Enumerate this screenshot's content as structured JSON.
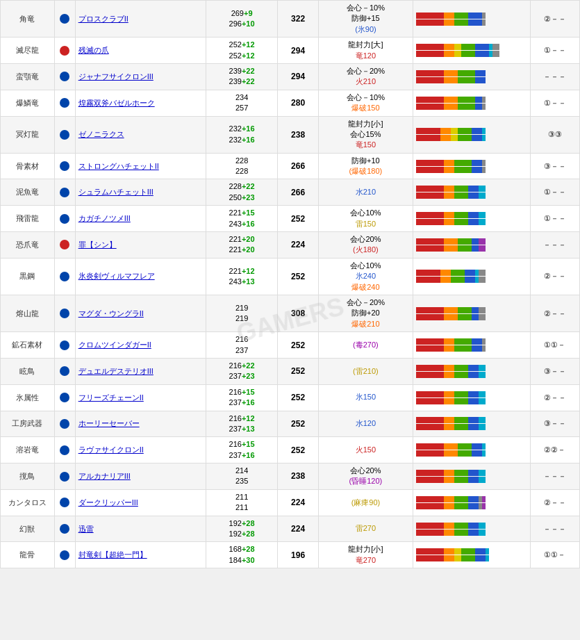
{
  "watermark": "GAMERS",
  "rows": [
    {
      "type": "角竜",
      "icon": "blue",
      "name": "プロスクラブII",
      "atk1": "269",
      "atk1p": "+9",
      "atk2": "296",
      "atk2p": "+10",
      "total": "322",
      "eff_line1": "会心－10%",
      "eff_line2": "防御+15",
      "eff_line3": "(氷90)",
      "eff1_color": "normal",
      "eff2_color": "normal",
      "eff3_color": "blue_paren",
      "rank": "②－－",
      "bars": [
        [
          40,
          15,
          0,
          20,
          20,
          0,
          5,
          0
        ],
        [
          40,
          15,
          0,
          20,
          20,
          0,
          5,
          0
        ]
      ]
    },
    {
      "type": "滅尽龍",
      "icon": "red",
      "name": "残滅の爪",
      "atk1": "252",
      "atk1p": "+12",
      "atk2": "252",
      "atk2p": "+12",
      "total": "294",
      "eff_line1": "龍封力[大]",
      "eff_line2": "竜120",
      "eff_line3": "",
      "eff1_color": "normal",
      "eff2_color": "red",
      "eff3_color": "normal",
      "rank": "①－－",
      "bars": [
        [
          40,
          15,
          10,
          20,
          20,
          5,
          10,
          0
        ],
        [
          40,
          15,
          10,
          20,
          20,
          5,
          10,
          0
        ]
      ]
    },
    {
      "type": "蛮顎竜",
      "icon": "blue",
      "name": "ジャナフサイクロンIII",
      "atk1": "239",
      "atk1p": "+22",
      "atk2": "239",
      "atk2p": "+22",
      "total": "294",
      "eff_line1": "会心－20%",
      "eff_line2": "火210",
      "eff_line3": "",
      "eff1_color": "normal",
      "eff2_color": "red",
      "eff3_color": "normal",
      "rank": "－－－",
      "bars": [
        [
          40,
          20,
          0,
          25,
          15,
          0,
          0,
          0
        ],
        [
          40,
          20,
          0,
          25,
          15,
          0,
          0,
          0
        ]
      ]
    },
    {
      "type": "爆鱗竜",
      "icon": "blue",
      "name": "煌霧双斧バゼルホーク",
      "atk1": "234",
      "atk1p": "",
      "atk2": "257",
      "atk2p": "",
      "total": "280",
      "eff_line1": "会心－10%",
      "eff_line2": "爆破150",
      "eff_line3": "",
      "eff1_color": "normal",
      "eff2_color": "orange",
      "eff3_color": "normal",
      "rank": "①－－",
      "bars": [
        [
          40,
          20,
          0,
          25,
          10,
          0,
          5,
          0
        ],
        [
          40,
          20,
          0,
          25,
          10,
          0,
          5,
          0
        ]
      ]
    },
    {
      "type": "冥灯龍",
      "icon": "blue",
      "name": "ゼノニラクス",
      "atk1": "232",
      "atk1p": "+16",
      "atk2": "232",
      "atk2p": "+16",
      "total": "238",
      "eff_line1": "龍封力[小]",
      "eff_line2": "会心15%",
      "eff_line3": "竜150",
      "eff1_color": "normal",
      "eff2_color": "normal",
      "eff3_color": "red",
      "rank": "③③",
      "bars": [
        [
          35,
          15,
          10,
          20,
          15,
          5,
          0,
          0
        ],
        [
          35,
          15,
          10,
          20,
          15,
          5,
          0,
          0
        ]
      ]
    },
    {
      "type": "骨素材",
      "icon": "blue",
      "name": "ストロングハチェットII",
      "atk1": "228",
      "atk1p": "",
      "atk2": "228",
      "atk2p": "",
      "total": "266",
      "eff_line1": "防御+10",
      "eff_line2": "(爆破180)",
      "eff_line3": "",
      "eff1_color": "normal",
      "eff2_color": "orange_paren",
      "eff3_color": "normal",
      "rank": "③－－",
      "bars": [
        [
          40,
          15,
          0,
          25,
          15,
          0,
          5,
          0
        ],
        [
          40,
          15,
          0,
          25,
          15,
          0,
          5,
          0
        ]
      ]
    },
    {
      "type": "泥魚竜",
      "icon": "blue",
      "name": "シュラムハチェットIII",
      "atk1": "228",
      "atk1p": "+22",
      "atk2": "250",
      "atk2p": "+23",
      "total": "266",
      "eff_line1": "水210",
      "eff_line2": "",
      "eff_line3": "",
      "eff1_color": "blue",
      "eff2_color": "normal",
      "eff3_color": "normal",
      "rank": "①－－",
      "bars": [
        [
          40,
          15,
          0,
          20,
          15,
          10,
          0,
          0
        ],
        [
          40,
          15,
          0,
          20,
          15,
          10,
          0,
          0
        ]
      ]
    },
    {
      "type": "飛雷龍",
      "icon": "blue",
      "name": "カガチノツメIII",
      "atk1": "221",
      "atk1p": "+15",
      "atk2": "243",
      "atk2p": "+16",
      "total": "252",
      "eff_line1": "会心10%",
      "eff_line2": "雷150",
      "eff_line3": "",
      "eff1_color": "normal",
      "eff2_color": "yellow",
      "eff3_color": "normal",
      "rank": "①－－",
      "bars": [
        [
          40,
          15,
          0,
          20,
          15,
          10,
          0,
          0
        ],
        [
          40,
          15,
          0,
          20,
          15,
          10,
          0,
          0
        ]
      ]
    },
    {
      "type": "恐爪竜",
      "icon": "red",
      "name": "罪【シン】",
      "atk1": "221",
      "atk1p": "+20",
      "atk2": "221",
      "atk2p": "+20",
      "total": "224",
      "eff_line1": "会心20%",
      "eff_line2": "(火180)",
      "eff_line3": "",
      "eff1_color": "normal",
      "eff2_color": "red_paren",
      "eff3_color": "normal",
      "rank": "－－－",
      "bars": [
        [
          40,
          20,
          0,
          20,
          10,
          0,
          0,
          10
        ],
        [
          40,
          20,
          0,
          20,
          10,
          0,
          0,
          10
        ]
      ]
    },
    {
      "type": "黒鋼",
      "icon": "blue",
      "name": "氷炎剣ヴィルマフレア",
      "atk1": "221",
      "atk1p": "+12",
      "atk2": "243",
      "atk2p": "+13",
      "total": "252",
      "eff_line1": "会心10%",
      "eff_line2": "氷240",
      "eff_line3": "爆破240",
      "eff1_color": "normal",
      "eff2_color": "blue",
      "eff3_color": "orange",
      "rank": "②－－",
      "bars": [
        [
          35,
          15,
          0,
          20,
          15,
          5,
          10,
          0
        ],
        [
          35,
          15,
          0,
          20,
          15,
          5,
          10,
          0
        ]
      ]
    },
    {
      "type": "熔山龍",
      "icon": "blue",
      "name": "マグダ・ウングラII",
      "atk1": "219",
      "atk1p": "",
      "atk2": "219",
      "atk2p": "",
      "total": "308",
      "eff_line1": "会心－20%",
      "eff_line2": "防御+20",
      "eff_line3": "爆破210",
      "eff1_color": "normal",
      "eff2_color": "normal",
      "eff3_color": "orange",
      "rank": "②－－",
      "bars": [
        [
          40,
          20,
          0,
          20,
          10,
          0,
          10,
          0
        ],
        [
          40,
          20,
          0,
          20,
          10,
          0,
          10,
          0
        ]
      ]
    },
    {
      "type": "鉱石素材",
      "icon": "blue",
      "name": "クロムツインダガーII",
      "atk1": "216",
      "atk1p": "",
      "atk2": "237",
      "atk2p": "",
      "total": "252",
      "eff_line1": "(毒270)",
      "eff_line2": "",
      "eff_line3": "",
      "eff1_color": "purple_paren",
      "eff2_color": "normal",
      "eff3_color": "normal",
      "rank": "①①－",
      "bars": [
        [
          40,
          15,
          0,
          25,
          15,
          0,
          5,
          0
        ],
        [
          40,
          15,
          0,
          25,
          15,
          0,
          5,
          0
        ]
      ]
    },
    {
      "type": "眩鳥",
      "icon": "blue",
      "name": "デュエルデステリオIII",
      "atk1": "216",
      "atk1p": "+22",
      "atk2": "237",
      "atk2p": "+23",
      "total": "252",
      "eff_line1": "(雷210)",
      "eff_line2": "",
      "eff_line3": "",
      "eff1_color": "yellow_paren",
      "eff2_color": "normal",
      "eff3_color": "normal",
      "rank": "③－－",
      "bars": [
        [
          40,
          15,
          0,
          20,
          15,
          10,
          0,
          0
        ],
        [
          40,
          15,
          0,
          20,
          15,
          10,
          0,
          0
        ]
      ]
    },
    {
      "type": "氷属性",
      "icon": "blue",
      "name": "フリーズチェーンII",
      "atk1": "216",
      "atk1p": "+15",
      "atk2": "237",
      "atk2p": "+16",
      "total": "252",
      "eff_line1": "氷150",
      "eff_line2": "",
      "eff_line3": "",
      "eff1_color": "blue",
      "eff2_color": "normal",
      "eff3_color": "normal",
      "rank": "②－－",
      "bars": [
        [
          40,
          15,
          0,
          20,
          15,
          10,
          0,
          0
        ],
        [
          40,
          15,
          0,
          20,
          15,
          10,
          0,
          0
        ]
      ]
    },
    {
      "type": "工房武器",
      "icon": "blue",
      "name": "ホーリーセーバー",
      "atk1": "216",
      "atk1p": "+12",
      "atk2": "237",
      "atk2p": "+13",
      "total": "252",
      "eff_line1": "水120",
      "eff_line2": "",
      "eff_line3": "",
      "eff1_color": "blue",
      "eff2_color": "normal",
      "eff3_color": "normal",
      "rank": "③－－",
      "bars": [
        [
          40,
          15,
          0,
          20,
          15,
          10,
          0,
          0
        ],
        [
          40,
          15,
          0,
          20,
          15,
          10,
          0,
          0
        ]
      ]
    },
    {
      "type": "溶岩竜",
      "icon": "blue",
      "name": "ラヴァサイクロンII",
      "atk1": "216",
      "atk1p": "+15",
      "atk2": "237",
      "atk2p": "+16",
      "total": "252",
      "eff_line1": "火150",
      "eff_line2": "",
      "eff_line3": "",
      "eff1_color": "red",
      "eff2_color": "normal",
      "eff3_color": "normal",
      "rank": "②②－",
      "bars": [
        [
          40,
          20,
          0,
          20,
          15,
          5,
          0,
          0
        ],
        [
          40,
          20,
          0,
          20,
          15,
          5,
          0,
          0
        ]
      ]
    },
    {
      "type": "撹鳥",
      "icon": "blue",
      "name": "アルカナリアIII",
      "atk1": "214",
      "atk1p": "",
      "atk2": "235",
      "atk2p": "",
      "total": "238",
      "eff_line1": "会心20%",
      "eff_line2": "(昏睡120)",
      "eff_line3": "",
      "eff1_color": "normal",
      "eff2_color": "purple_paren",
      "eff3_color": "normal",
      "rank": "－－－",
      "bars": [
        [
          40,
          15,
          0,
          20,
          15,
          10,
          0,
          0
        ],
        [
          40,
          15,
          0,
          20,
          15,
          10,
          0,
          0
        ]
      ]
    },
    {
      "type": "カンタロス",
      "icon": "blue",
      "name": "ダークリッパーIII",
      "atk1": "211",
      "atk1p": "",
      "atk2": "211",
      "atk2p": "",
      "total": "224",
      "eff_line1": "(麻痺90)",
      "eff_line2": "",
      "eff_line3": "",
      "eff1_color": "yellow_paren",
      "eff2_color": "normal",
      "eff3_color": "normal",
      "rank": "②－－",
      "bars": [
        [
          40,
          15,
          0,
          20,
          15,
          0,
          5,
          5
        ],
        [
          40,
          15,
          0,
          20,
          15,
          0,
          5,
          5
        ]
      ]
    },
    {
      "type": "幻獣",
      "icon": "blue",
      "name": "迅雷",
      "atk1": "192",
      "atk1p": "+28",
      "atk2": "192",
      "atk2p": "+28",
      "total": "224",
      "eff_line1": "雷270",
      "eff_line2": "",
      "eff_line3": "",
      "eff1_color": "yellow",
      "eff2_color": "normal",
      "eff3_color": "normal",
      "rank": "－－－",
      "bars": [
        [
          40,
          15,
          0,
          20,
          15,
          10,
          0,
          0
        ],
        [
          40,
          15,
          0,
          20,
          15,
          10,
          0,
          0
        ]
      ]
    },
    {
      "type": "龍骨",
      "icon": "blue",
      "name": "封竜剣【超絶一門】",
      "atk1": "168",
      "atk1p": "+28",
      "atk2": "184",
      "atk2p": "+30",
      "total": "196",
      "eff_line1": "龍封力[小]",
      "eff_line2": "竜270",
      "eff_line3": "",
      "eff1_color": "normal",
      "eff2_color": "red",
      "eff3_color": "normal",
      "rank": "①①－",
      "bars": [
        [
          40,
          15,
          10,
          20,
          15,
          5,
          0,
          0
        ],
        [
          40,
          15,
          10,
          20,
          15,
          5,
          0,
          0
        ]
      ]
    }
  ]
}
